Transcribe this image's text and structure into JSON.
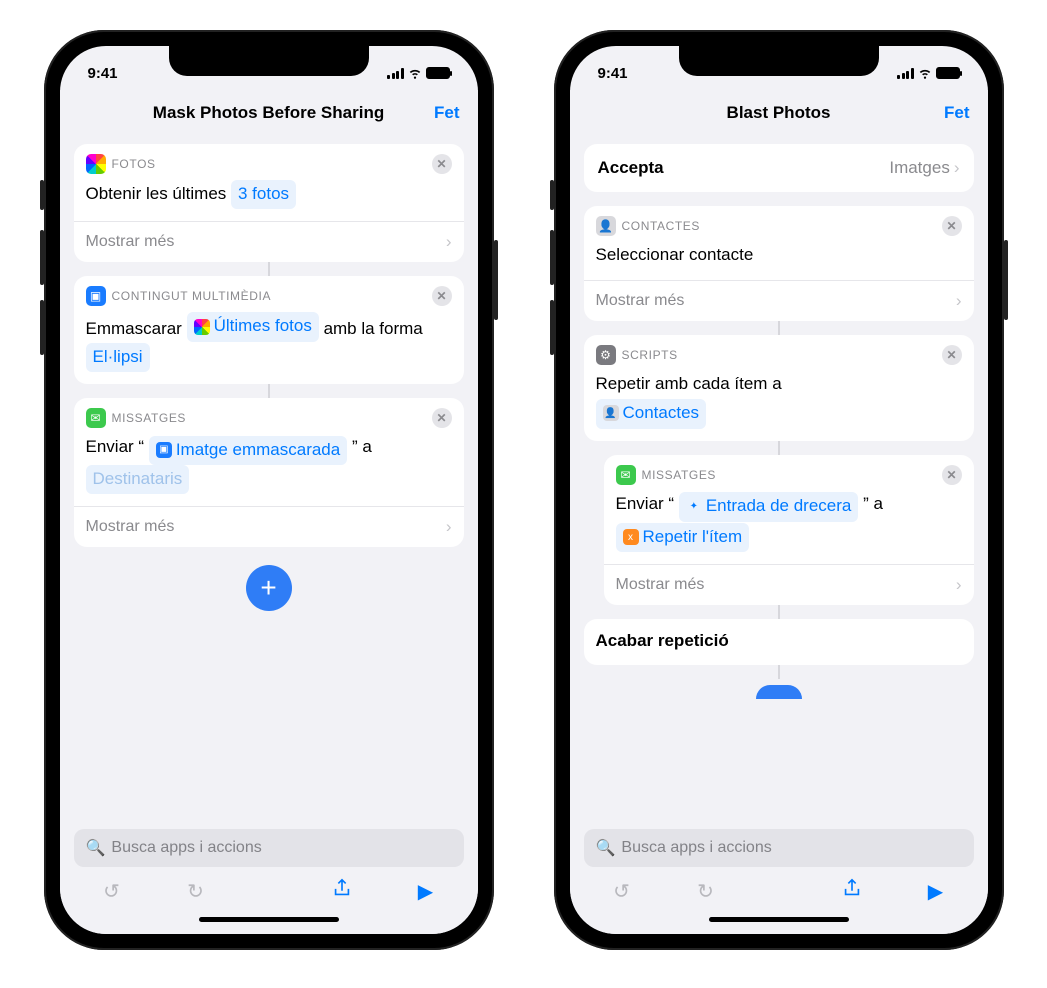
{
  "statusbar": {
    "time": "9:41"
  },
  "common": {
    "done": "Fet",
    "show_more": "Mostrar més",
    "search_placeholder": "Busca apps i accions"
  },
  "left": {
    "title": "Mask Photos Before Sharing",
    "cards": {
      "photos": {
        "label": "FOTOS",
        "text_prefix": "Obtenir les últimes ",
        "token": "3 fotos"
      },
      "media": {
        "label": "CONTINGUT MULTIMÈDIA",
        "t1": "Emmascarar ",
        "token1": "Últimes fotos",
        "t2": " amb la forma ",
        "token2": "El·lipsi"
      },
      "messages": {
        "label": "MISSATGES",
        "t1": "Enviar “",
        "token1": "Imatge emmascarada",
        "t2": "” a ",
        "token2": "Destinataris"
      }
    }
  },
  "right": {
    "title": "Blast Photos",
    "accepts": {
      "key": "Accepta",
      "value": "Imatges"
    },
    "cards": {
      "contacts": {
        "label": "CONTACTES",
        "body": "Seleccionar contacte"
      },
      "scripts": {
        "label": "SCRIPTS",
        "t1": "Repetir amb cada ítem a",
        "token": "Contactes"
      },
      "messages": {
        "label": "MISSATGES",
        "t1": "Enviar “",
        "token1": "Entrada de drecera",
        "t2": "” a ",
        "token2": "Repetir l'ítem"
      },
      "end": {
        "body": "Acabar repetició"
      }
    }
  }
}
